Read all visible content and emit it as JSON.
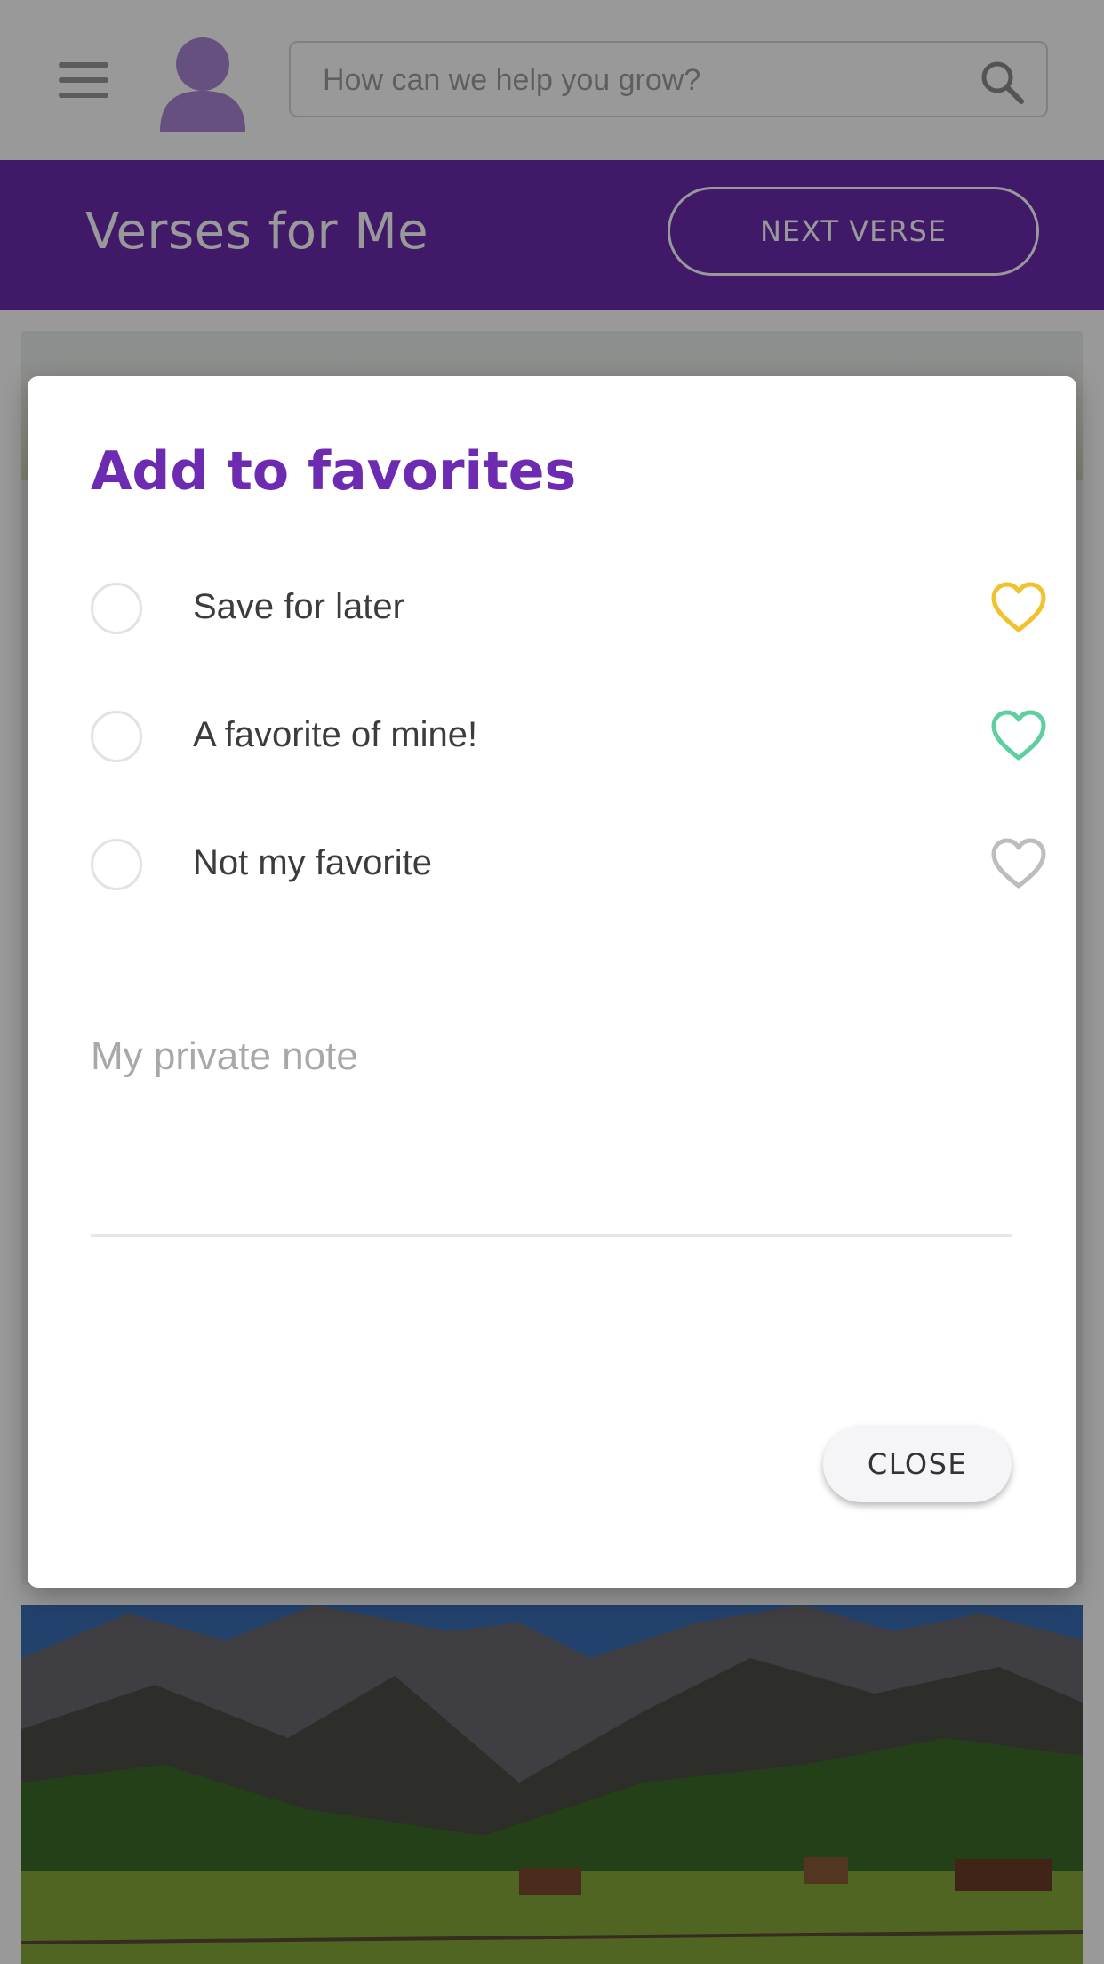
{
  "header": {
    "search_placeholder": "How can we help you grow?",
    "menu_icon": "hamburger-icon",
    "avatar_icon": "user-avatar-icon",
    "search_icon": "search-icon"
  },
  "banner": {
    "title": "Verses for Me",
    "next_button": "NEXT VERSE",
    "color": "#6c2bb0"
  },
  "dialog": {
    "title": "Add to favorites",
    "options": [
      {
        "label": "Save for later",
        "heart_color": "#f2c22e",
        "selected": false
      },
      {
        "label": "A favorite of mine!",
        "heart_color": "#5fcf9f",
        "selected": false
      },
      {
        "label": "Not my favorite",
        "heart_color": "#bdbdbd",
        "selected": false
      }
    ],
    "note_placeholder": "My private note",
    "close_label": "CLOSE"
  }
}
